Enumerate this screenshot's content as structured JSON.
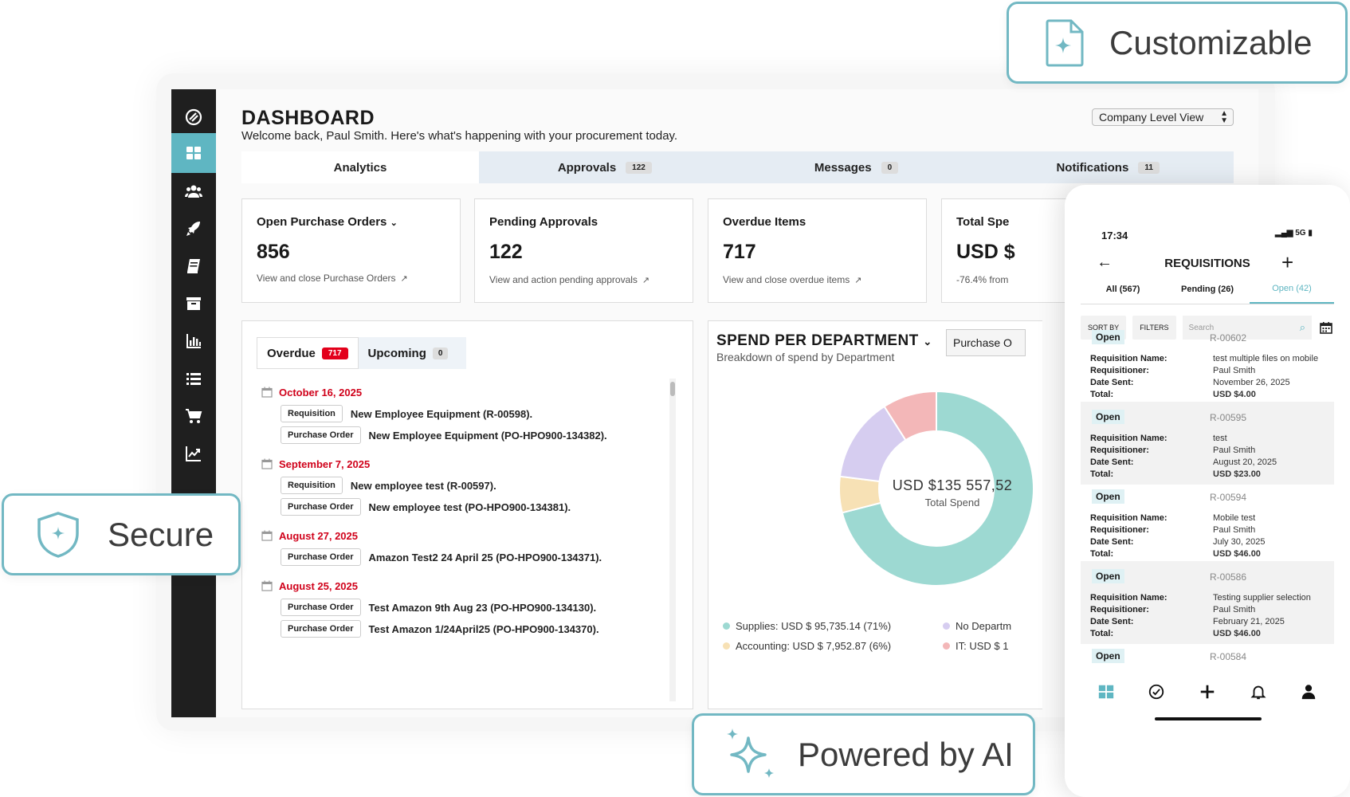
{
  "dashboard": {
    "title": "DASHBOARD",
    "welcome": "Welcome back, Paul Smith. Here's what's happening with your procurement today.",
    "view_select": "Company Level View"
  },
  "tabs": [
    {
      "label": "Analytics",
      "count": ""
    },
    {
      "label": "Approvals",
      "count": "122"
    },
    {
      "label": "Messages",
      "count": "0"
    },
    {
      "label": "Notifications",
      "count": "11"
    }
  ],
  "cards": [
    {
      "title": "Open Purchase Orders",
      "value": "856",
      "link": "View and close Purchase Orders"
    },
    {
      "title": "Pending Approvals",
      "value": "122",
      "link": "View and action pending approvals"
    },
    {
      "title": "Overdue Items",
      "value": "717",
      "link": "View and close overdue items"
    },
    {
      "title": "Total Spe",
      "value": "USD $",
      "link": "-76.4% from"
    }
  ],
  "overdue": {
    "overdue_label": "Overdue",
    "overdue_count": "717",
    "upcoming_label": "Upcoming",
    "upcoming_count": "0",
    "groups": [
      {
        "date": "October 16, 2025",
        "items": [
          {
            "type": "Requisition",
            "text": "New Employee Equipment (R-00598)."
          },
          {
            "type": "Purchase Order",
            "text": "New Employee Equipment (PO-HPO900-134382)."
          }
        ]
      },
      {
        "date": "September 7, 2025",
        "items": [
          {
            "type": "Requisition",
            "text": "New employee test (R-00597)."
          },
          {
            "type": "Purchase Order",
            "text": "New employee test (PO-HPO900-134381)."
          }
        ]
      },
      {
        "date": "August 27, 2025",
        "items": [
          {
            "type": "Purchase Order",
            "text": "Amazon Test2 24 April 25 (PO-HPO900-134371)."
          }
        ]
      },
      {
        "date": "August 25, 2025",
        "items": [
          {
            "type": "Purchase Order",
            "text": "Test Amazon 9th Aug 23 (PO-HPO900-134130)."
          },
          {
            "type": "Purchase Order",
            "text": "Test Amazon 1/24April25 (PO-HPO900-134370)."
          }
        ]
      }
    ]
  },
  "spend": {
    "title": "SPEND PER DEPARTMENT",
    "subtitle": "Breakdown of spend by Department",
    "select": "Purchase O",
    "total": "USD $135 557,52",
    "total_label": "Total Spend",
    "legend": [
      {
        "label": "Supplies: USD $ 95,735.14 (71%)",
        "color": "#9dd9d2"
      },
      {
        "label": "No Departm",
        "color": "#d6cdf0"
      },
      {
        "label": "Accounting: USD $ 7,952.87 (6%)",
        "color": "#f7e1b5"
      },
      {
        "label": "IT: USD $ 1",
        "color": "#f3b7b8"
      }
    ]
  },
  "chart_data": {
    "type": "pie",
    "categories": [
      "Supplies",
      "Accounting",
      "No Department",
      "IT"
    ],
    "values": [
      71,
      6,
      14,
      9
    ],
    "colors": [
      "#9dd9d2",
      "#f7e1b5",
      "#d6cdf0",
      "#f3b7b8"
    ],
    "title": "SPEND PER DEPARTMENT"
  },
  "phone": {
    "time": "17:34",
    "status": "5G",
    "title": "REQUISITIONS",
    "tabs": [
      "All (567)",
      "Pending (26)",
      "Open (42)"
    ],
    "sort": "SORT BY",
    "filters": "FILTERS",
    "search_placeholder": "Search",
    "labels": {
      "name": "Requisition Name:",
      "requisitioner": "Requisitioner:",
      "date": "Date Sent:",
      "total": "Total:"
    },
    "items": [
      {
        "status": "Open",
        "id": "R-00602",
        "name": "test multiple files on mobile",
        "requisitioner": "Paul Smith",
        "date": "November 26, 2025",
        "total": "USD $4.00"
      },
      {
        "status": "Open",
        "id": "R-00595",
        "name": "test",
        "requisitioner": "Paul Smith",
        "date": "August 20, 2025",
        "total": "USD $23.00"
      },
      {
        "status": "Open",
        "id": "R-00594",
        "name": "Mobile test",
        "requisitioner": "Paul Smith",
        "date": "July 30, 2025",
        "total": "USD $46.00"
      },
      {
        "status": "Open",
        "id": "R-00586",
        "name": "Testing supplier selection",
        "requisitioner": "Paul Smith",
        "date": "February 21, 2025",
        "total": "USD $46.00"
      },
      {
        "status": "Open",
        "id": "R-00584"
      }
    ]
  },
  "badges": {
    "customizable": "Customizable",
    "secure": "Secure",
    "ai": "Powered by AI"
  }
}
